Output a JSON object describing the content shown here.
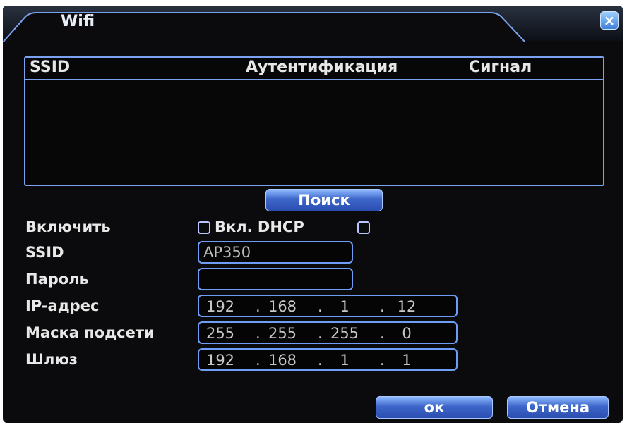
{
  "window": {
    "title": "Wifi",
    "close_icon": "close-icon"
  },
  "list": {
    "columns": [
      "SSID",
      "Аутентификация",
      "Сигнал"
    ]
  },
  "buttons": {
    "search": "Поиск",
    "ok": "ок",
    "cancel": "Отмена"
  },
  "form": {
    "enable_label": "Включить",
    "dhcp_label": "Вкл. DHCP",
    "ssid_label": "SSID",
    "ssid_value": "AP350",
    "password_label": "Пароль",
    "password_value": "",
    "ip_label": "IP-адрес",
    "ip_value": [
      "192",
      "168",
      "1",
      "12"
    ],
    "mask_label": "Маска подсети",
    "mask_value": [
      "255",
      "255",
      "255",
      "0"
    ],
    "gateway_label": "Шлюз",
    "gateway_value": [
      "192",
      "168",
      "1",
      "1"
    ]
  },
  "separator": "."
}
